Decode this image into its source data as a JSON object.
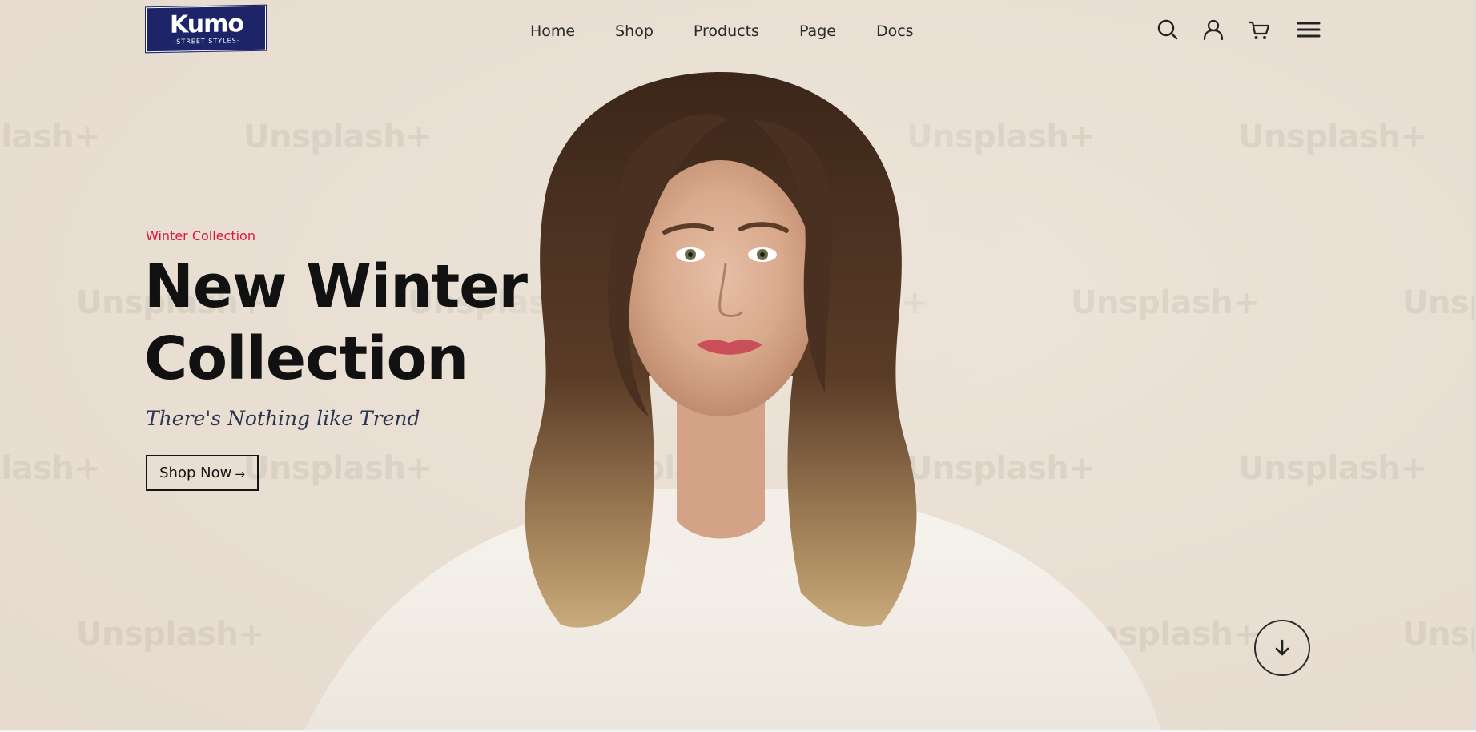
{
  "brand": {
    "name": "Kumo",
    "tagline": "·STREET STYLES·",
    "color": "#1d2467"
  },
  "nav": {
    "items": [
      "Home",
      "Shop",
      "Products",
      "Page",
      "Docs"
    ]
  },
  "header_icons": [
    "search-icon",
    "user-icon",
    "cart-icon",
    "menu-icon"
  ],
  "hero": {
    "eyebrow": "Winter Collection",
    "title_line1": "New Winter",
    "title_line2": "Collection",
    "subtitle": "There's Nothing like Trend",
    "cta_label": "Shop Now",
    "cta_arrow": "→",
    "accent_color": "#e0153b",
    "scroll_icon": "arrow-down-icon"
  },
  "watermark": {
    "text": "Unsplash+"
  }
}
